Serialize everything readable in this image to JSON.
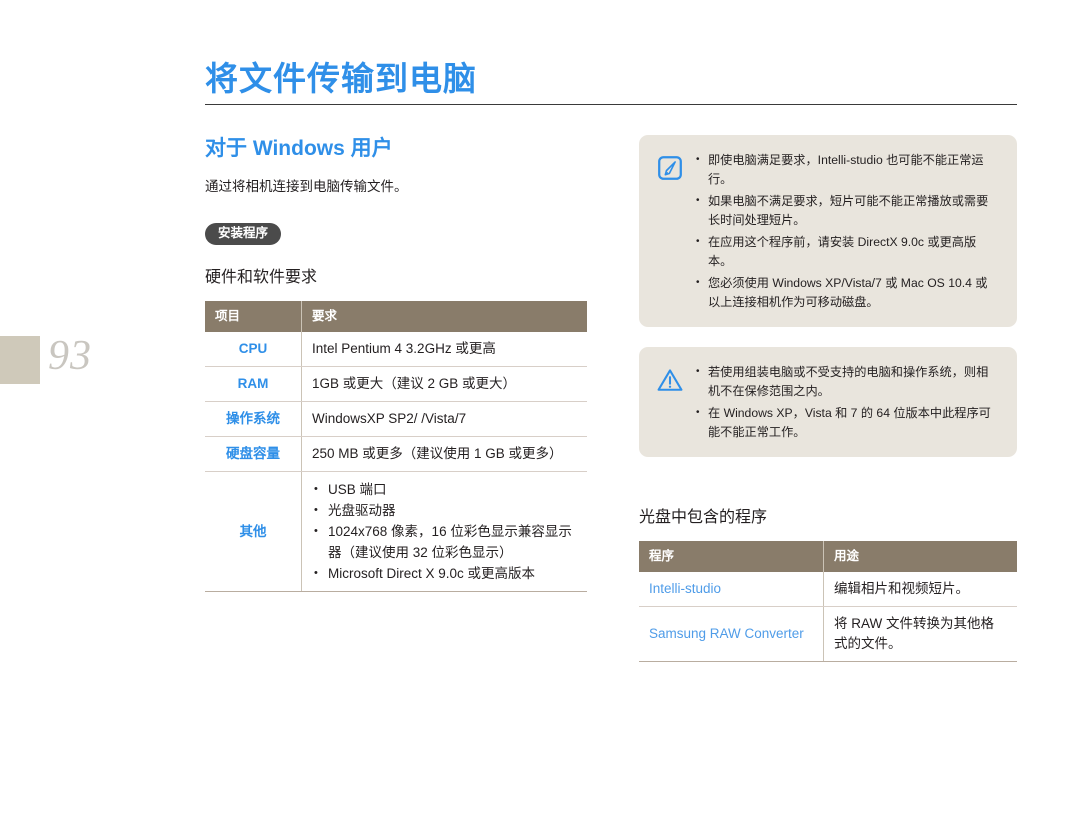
{
  "page": {
    "folio": "93",
    "title": "将文件传输到电脑"
  },
  "left_column": {
    "section_heading": "对于 Windows 用户",
    "intro": "通过将相机连接到电脑传输文件。",
    "badge": "安装程序",
    "sub_heading": "硬件和软件要求",
    "requirements_table": {
      "headers": [
        "项目",
        "要求"
      ],
      "rows": [
        {
          "key": "CPU",
          "value": "Intel Pentium 4 3.2GHz 或更高",
          "bullets": []
        },
        {
          "key": "RAM",
          "value": "1GB 或更大（建议 2 GB 或更大）",
          "bullets": []
        },
        {
          "key": "操作系统",
          "value": "WindowsXP SP2/ /Vista/7",
          "bullets": []
        },
        {
          "key": "硬盘容量",
          "value": "250 MB 或更多（建议使用 1 GB 或更多）",
          "bullets": []
        },
        {
          "key": "其他",
          "value": "",
          "bullets": [
            "USB 端口",
            "光盘驱动器",
            "1024x768 像素，16 位彩色显示兼容显示器（建议使用 32 位彩色显示）",
            "Microsoft Direct X 9.0c 或更高版本"
          ]
        }
      ]
    }
  },
  "right_column": {
    "note_callout": {
      "icon": "note-pencil-icon",
      "items": [
        "即使电脑满足要求，Intelli-studio 也可能不能正常运行。",
        "如果电脑不满足要求，短片可能不能正常播放或需要长时间处理短片。",
        "在应用这个程序前，请安装 DirectX 9.0c 或更高版本。",
        "您必须使用 Windows XP/Vista/7 或 Mac OS 10.4 或以上连接相机作为可移动磁盘。"
      ]
    },
    "warning_callout": {
      "icon": "warning-triangle-icon",
      "items": [
        "若使用组装电脑或不受支持的电脑和操作系统，则相机不在保修范围之内。",
        "在 Windows XP，Vista 和 7 的 64 位版本中此程序可能不能正常工作。"
      ]
    },
    "sub_heading": "光盘中包含的程序",
    "programs_table": {
      "headers": [
        "程序",
        "用途"
      ],
      "rows": [
        {
          "name": "Intelli-studio",
          "purpose": "编辑相片和视频短片。"
        },
        {
          "name": "Samsung RAW Converter",
          "purpose": "将 RAW 文件转换为其他格式的文件。"
        }
      ]
    }
  },
  "colors": {
    "accent_blue": "#2f8fe8",
    "link_blue": "#4f9ce8",
    "table_header": "#897c6a",
    "callout_bg": "#e9e5dd",
    "badge_bg": "#4b4b4b",
    "tab_beige": "#cfc9ba",
    "rule_dark": "#3a3a3a"
  }
}
